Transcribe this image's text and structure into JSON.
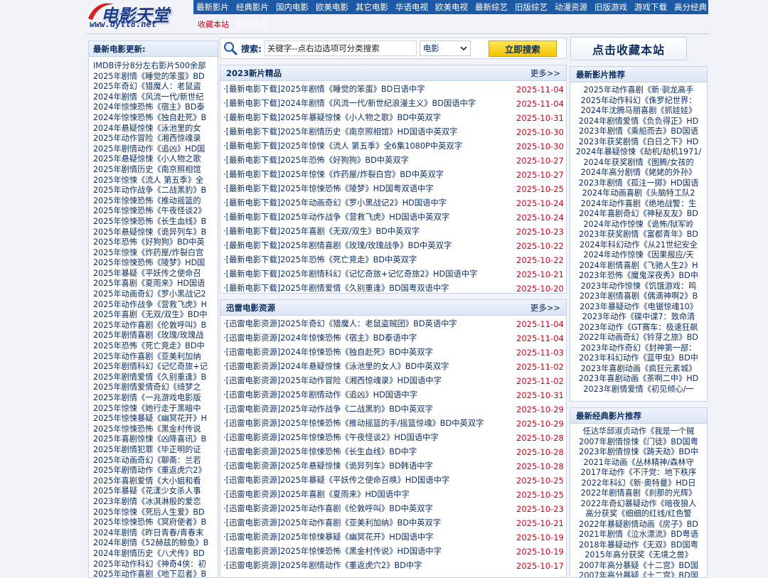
{
  "logo": {
    "main": "电影天堂",
    "sub": "www.dytt8.net"
  },
  "topnav": [
    "最新影片",
    "经典影片",
    "国内电影",
    "欧美电影",
    "其它电影",
    "华语电视",
    "欧美电视",
    "最新综艺",
    "旧版综艺",
    "动漫资源",
    "旧版游戏",
    "游戏下载",
    "高分经典"
  ],
  "subnav": {
    "bookmark": "收藏本站",
    "faint": "设为首页"
  },
  "left": {
    "title": "最新电影更新:",
    "items": [
      "IMDB评分8分左右影片500余部",
      "2025年剧情《睡觉的笨蛋》BD",
      "2025年奇幻《猎魔人：老鼠盗",
      "2024年剧情《风流一代/新世纪",
      "2024年惊悚恐怖《宿主》BD泰",
      "2024年惊悚恐怖《独自赴死》B",
      "2024年悬疑惊悚《泳池里的女",
      "2025年动作冒险《湘西惊魂录",
      "2025年剧情动作《追凶》HD国",
      "2025年悬疑惊悚《小人物之歌",
      "2025年剧情历史《南京照相馆",
      "2025年惊悚《流人 第五季》全",
      "2025年动作战争《二战黑豹》B",
      "2025年惊悚恐怖《推动摇篮的",
      "2025年惊悚恐怖《午夜怪谈2》",
      "2025年惊悚恐怖《长生血线》B",
      "2025年悬疑惊悚《诡异列车》B",
      "2025年恐怖《好狗狗》BD中英",
      "2025年惊悚《炸药屋/炸裂白宫",
      "2025年惊悚恐怖《陵梦》HD国",
      "2025年暴疑《平妖传之使命召",
      "2025年喜剧《夏雨来》HD国语",
      "2025年动画奇幻《罗小黑战记2",
      "2025年动作战争《营救飞虎》H",
      "2025年喜剧《无双/双生》BD中",
      "2025年动作喜剧《伦敦呼叫》B",
      "2025年剧情喜剧《玫瑰/玫瑰战",
      "2025年恐怖《死亡竞走》BD中",
      "2025年动作喜剧《亚美利加纳",
      "2025年剧情科幻《记忆奇旅+记",
      "2025年剧情爱情《久别重逢》B",
      "2025年剧情爱情奇幻《绮梦之",
      "2025年剧情《一兆游戏电影版",
      "2025年惊悚《她行走于黑暗中",
      "2025年惊悚暴疑《幽冥花开》H",
      "2025年惊悚恐怖《黑金村传说",
      "2025年喜剧惊悚《凶降喜讯》B",
      "2025年剧情犯罪《毕正明的证",
      "2025年动画奇幻《聊斋：兰若",
      "2025年剧情动作《重返虎穴2》",
      "2025年喜剧爱情《大小姐和看",
      "2025年暴疑《花漾少女杀人事",
      "2023年剧情《冰淇淋般的爱恋",
      "2025年惊悚《死后人生爱》BD",
      "2025年惊悚恐怖《冥府使者》B",
      "2024年剧情《昨日青春/青春末",
      "2024年剧情《52赫兹的鲸鱼》B",
      "2024年剧情历史《八犬传》BD",
      "2025年动作科幻《神奇4侠：初",
      "2025年动作喜剧《地下忍者》B"
    ]
  },
  "search": {
    "label": "搜索:",
    "placeholder": "关键字--点右边选项可分类搜索",
    "select": "电影",
    "button": "立即搜索"
  },
  "favorite": "点击收藏本站",
  "panel_new": {
    "title": "2023新片精品",
    "more": "更多>>",
    "rows": [
      {
        "t": "·[最新电影下载]2025年剧情《睡觉的笨蛋》BD日语中字",
        "d": "2025-11-04"
      },
      {
        "t": "·[最新电影下载]2024年剧情《风流一代/新世纪浪漫主义》BD国语中字",
        "d": "2025-11-04"
      },
      {
        "t": "·[最新电影下载]2025年暴疑惊悚《小人物之歌》BD中英双字",
        "d": "2025-10-31"
      },
      {
        "t": "·[最新电影下载]2025年剧情历史《南京照相馆》HD国语中英双字",
        "d": "2025-10-30"
      },
      {
        "t": "·[最新电影下载]2025年惊悚《流人 第五季》全6集1080P中英双字",
        "d": "2025-10-30"
      },
      {
        "t": "·[最新电影下载]2025年恐怖《好狗狗》BD中英双字",
        "d": "2025-10-27"
      },
      {
        "t": "·[最新电影下载]2025年惊悚《炸药屋/炸裂白宫》BD中英双字",
        "d": "2025-10-27"
      },
      {
        "t": "·[最新电影下载]2025年惊悚恐怖《陵梦》HD国粤双语中字",
        "d": "2025-10-25"
      },
      {
        "t": "·[最新电影下载]2025年动画奇幻《罗小黑战记2》HD国语中字",
        "d": "2025-10-24"
      },
      {
        "t": "·[最新电影下载]2025年动作战争《营救飞虎》HD国语中英双字",
        "d": "2025-10-24"
      },
      {
        "t": "·[最新电影下载]2025年喜剧《无双/双生》BD中英双字",
        "d": "2025-10-23"
      },
      {
        "t": "·[最新电影下载]2025年剧情喜剧《玫瑰/玫瑰战争》BD中英双字",
        "d": "2025-10-22"
      },
      {
        "t": "·[最新电影下载]2025年恐怖《死亡竞走》BD中英双字",
        "d": "2025-10-22"
      },
      {
        "t": "·[最新电影下载]2025年剧情科幻《记忆奇旅+记忆奇旅2》HD国语中字",
        "d": "2025-10-21"
      },
      {
        "t": "·[最新电影下载]2025年剧情爱情《久别重逢》BD国粤双语中字",
        "d": "2025-10-20"
      }
    ]
  },
  "panel_thunder": {
    "title": "迅雷电影资源",
    "more": "更多>>",
    "rows": [
      {
        "t": "·[迅雷电影资源]2025年奇幻《猎魔人：老鼠盗贼团》BD英语中字",
        "d": "2025-11-04"
      },
      {
        "t": "·[迅雷电影资源]2024年惊悚恐怖《宿主》BD泰语中字",
        "d": "2025-11-04"
      },
      {
        "t": "·[迅雷电影资源]2024年惊悚恐怖《独自赴死》BD中英双字",
        "d": "2025-11-03"
      },
      {
        "t": "·[迅雷电影资源]2024年悬疑惊悚《泳池里的女人》BD中英双字",
        "d": "2025-11-02"
      },
      {
        "t": "·[迅雷电影资源]2025年动作冒险《湘西惊魂录》HD国语中字",
        "d": "2025-11-02"
      },
      {
        "t": "·[迅雷电影资源]2025年剧情动作《追凶》HD国语中字",
        "d": "2025-10-31"
      },
      {
        "t": "·[迅雷电影资源]2025年动作战争《二战黑豹》BD中英双字",
        "d": "2025-10-29"
      },
      {
        "t": "·[迅雷电影资源]2025年惊悚恐怖《推动摇篮的手/摇篮惊魂》BD中英双字",
        "d": "2025-10-29"
      },
      {
        "t": "·[迅雷电影资源]2025年惊悚恐怖《午夜怪谈2》HD国语中字",
        "d": "2025-10-28"
      },
      {
        "t": "·[迅雷电影资源]2025年惊悚恐怖《长生血线》BD中字",
        "d": "2025-10-28"
      },
      {
        "t": "·[迅雷电影资源]2025年悬疑惊悚《诡异列车》BD韩语中字",
        "d": "2025-10-28"
      },
      {
        "t": "·[迅雷电影资源]2025年暴疑《平妖传之使命召唤》HD国语中字",
        "d": "2025-10-25"
      },
      {
        "t": "·[迅雷电影资源]2025年喜剧《夏雨来》HD国语中字",
        "d": "2025-10-25"
      },
      {
        "t": "·[迅雷电影资源]2025年动作喜剧《伦敦呼叫》BD中英双字",
        "d": "2025-10-23"
      },
      {
        "t": "·[迅雷电影资源]2025年动作喜剧《亚美利加纳》BD中英双字",
        "d": "2025-10-21"
      },
      {
        "t": "·[迅雷电影资源]2025年惊悚暴疑《幽冥花开》HD国语中字",
        "d": "2025-10-19"
      },
      {
        "t": "·[迅雷电影资源]2025年惊悚恐怖《黑金村传说》HD国语中字",
        "d": "2025-10-19"
      },
      {
        "t": "·[迅雷电影资源]2025年剧情动作《重返虎穴2》BD中字",
        "d": "2025-10-17"
      }
    ]
  },
  "right_recommend": {
    "title": "最新影片推荐",
    "items": [
      "2025年动作喜剧《新·驯龙高手",
      "2025年动作科幻《侏罗纪世界：",
      "2024年沈腾马丽喜剧《抓娃娃》",
      "2024年剧情爱情《负负得正》HD",
      "2023年剧情《乘船而去》BD国语",
      "2023年获奖剧情《白日之下》HD",
      "2024年暴疑惊悚《劫机/劫机1971/",
      "2024年获奖剧情《图腾/女孩的",
      "2024年高分剧情《姥姥的外孙》",
      "2023年剧情《孤注一掷》HD国语",
      "2024年动画喜剧《头脑特工队2",
      "2024年动作喜剧《绝地战警：生",
      "2024年喜剧奇幻《神秘友友》BD",
      "2024年动作惊悚《诡怖/狱军岭",
      "2023年获奖剧情《富都青年》BD",
      "2024年科幻动作《从21世纪安全",
      "2024年动作惊悚《因果报应/天",
      "2024年剧情喜剧《飞驰人生2》H",
      "2023年恐怖《魔鬼深夜秀》BD中",
      "2023年动作惊悚《饥饿游戏：鸣",
      "2023年剧情喜剧《偶滴神啊2》B",
      "2023年暴疑动作《电锯惊魂10》",
      "2023年动作《碟中谍7：致命清",
      "2023年动作《GT赛车：极速狂飙",
      "2022年动画奇幻《铃芽之旅》BD",
      "2023年动作奇幻《封神第一部：",
      "2023年科幻动作《蓝甲虫》BD中",
      "2023年喜剧动画《疯狂元素城》",
      "2023年喜剧动画《茶啊二中》HD",
      "2023年剧情爱情《初见倾心/一"
    ]
  },
  "right_classic": {
    "title": "最新经典影片推荐",
    "items": [
      "任达华邱淑贞动作《我是一个贼",
      "2007年剧情惊悚《门徒》BD国粤",
      "2023年剧情惊悚《踌天劫》BD中",
      "2021年动画《丛林精神/森林守",
      "2017年动作《不汗党：地下秩序",
      "2022年科幻《新·奥特曼》HD日",
      "2022年剧情喜剧《刹那的光辉》",
      "2022年奇幻暴疑动作《暗夜狼人",
      "高分获奖《细细的红线/红色警",
      "2022年暴疑剧情动画《房子》BD",
      "2021年剧情《泣水漂流》BD粤语",
      "2018年暴疑动作《无双》BD国粤",
      "2015年高分获奖《无境之兽》",
      "2007年高分暴疑《十二宫》BD国",
      "2007年高分暴疑《十二宫》BD国"
    ]
  }
}
